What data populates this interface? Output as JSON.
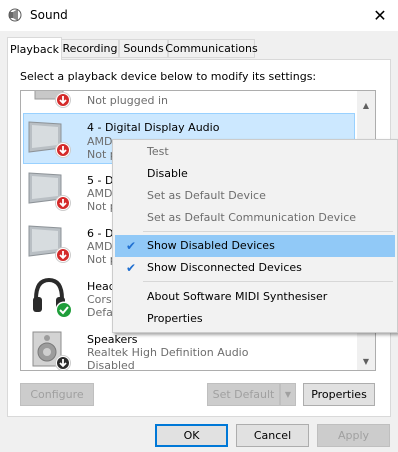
{
  "window": {
    "title": "Sound",
    "icon": "speaker-icon",
    "close_glyph": "✕"
  },
  "tabs": [
    {
      "label": "Playback",
      "active": true
    },
    {
      "label": "Recording",
      "active": false
    },
    {
      "label": "Sounds",
      "active": false
    },
    {
      "label": "Communications",
      "active": false
    }
  ],
  "instruction": "Select a playback device below to modify its settings:",
  "devices": [
    {
      "icon": "speaker-icon",
      "status_icon": "red-down-arrow-icon",
      "name": "",
      "subtitle": "Not plugged in"
    },
    {
      "icon": "monitor-icon",
      "status_icon": "red-down-arrow-icon",
      "name": "4 - Digital Display Audio",
      "line2": "AMD",
      "line3": "Not p"
    },
    {
      "icon": "monitor-icon",
      "status_icon": "red-down-arrow-icon",
      "name": "5 - D",
      "line2": "AMD",
      "line3": "Not p"
    },
    {
      "icon": "monitor-icon",
      "status_icon": "red-down-arrow-icon",
      "name": "6 - D",
      "line2": "AMD",
      "line3": "Not p"
    },
    {
      "icon": "headphones-icon",
      "status_icon": "green-check-icon",
      "name": "Head",
      "line2": "Corsa",
      "line3": "Defa"
    },
    {
      "icon": "speaker-icon",
      "status_icon": "black-down-arrow-icon",
      "name": "Speakers",
      "line2": "Realtek High Definition Audio",
      "line3": "Disabled"
    }
  ],
  "buttons": {
    "configure": "Configure",
    "set_default": "Set Default",
    "properties": "Properties",
    "ok": "OK",
    "cancel": "Cancel",
    "apply": "Apply"
  },
  "context_menu": {
    "items": [
      {
        "label": "Test",
        "disabled": true
      },
      {
        "label": "Disable",
        "disabled": false
      },
      {
        "label": "Set as Default Device",
        "disabled": true
      },
      {
        "label": "Set as Default Communication Device",
        "disabled": true
      },
      {
        "label": "Show Disabled Devices",
        "checked": true,
        "highlighted": true
      },
      {
        "label": "Show Disconnected Devices",
        "checked": true
      },
      {
        "label": "About Software MIDI Synthesiser"
      },
      {
        "label": "Properties"
      }
    ]
  }
}
